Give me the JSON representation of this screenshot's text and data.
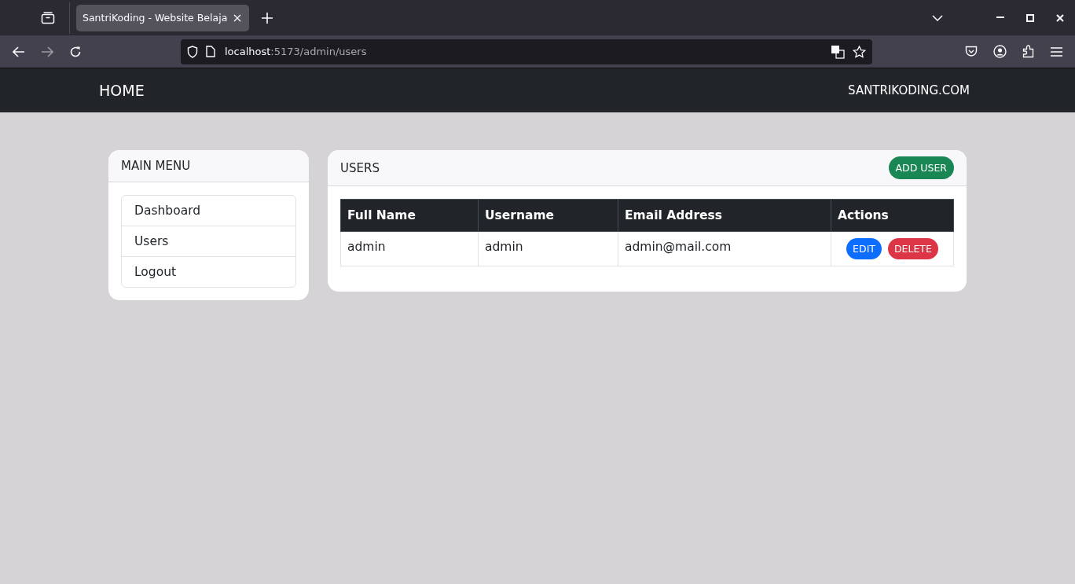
{
  "browser": {
    "tab_title": "SantriKoding - Website Belaja",
    "url_host": "localhost",
    "url_path": ":5173/admin/users"
  },
  "navbar": {
    "brand": "HOME",
    "right_link": "SANTRIKODING.COM"
  },
  "sidebar": {
    "title": "MAIN MENU",
    "items": [
      "Dashboard",
      "Users",
      "Logout"
    ]
  },
  "users": {
    "title": "USERS",
    "add_button": "ADD USER",
    "table": {
      "columns": [
        "Full Name",
        "Username",
        "Email Address",
        "Actions"
      ],
      "rows": [
        {
          "cells": [
            "admin",
            "admin",
            "admin@mail.com"
          ],
          "actions": [
            {
              "kind": "edit",
              "label": "EDIT"
            },
            {
              "kind": "delete",
              "label": "DELETE"
            }
          ]
        }
      ]
    }
  }
}
